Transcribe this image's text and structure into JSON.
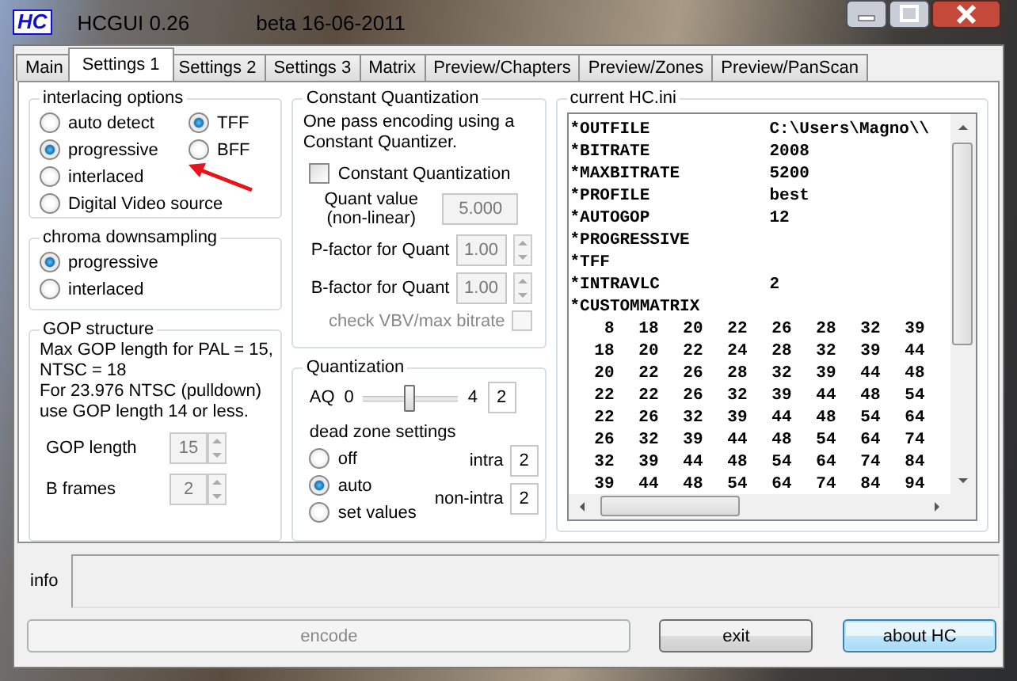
{
  "window": {
    "logo": "HC",
    "title": "HCGUI 0.26",
    "subtitle": "beta 16-06-2011"
  },
  "tabs": [
    {
      "label": "Main",
      "selected": false
    },
    {
      "label": "Settings 1",
      "selected": true
    },
    {
      "label": "Settings 2",
      "selected": false
    },
    {
      "label": "Settings 3",
      "selected": false
    },
    {
      "label": "Matrix",
      "selected": false
    },
    {
      "label": "Preview/Chapters",
      "selected": false
    },
    {
      "label": "Preview/Zones",
      "selected": false
    },
    {
      "label": "Preview/PanScan",
      "selected": false
    }
  ],
  "interlacing": {
    "title": "interlacing options",
    "options": [
      {
        "label": "auto detect",
        "selected": false
      },
      {
        "label": "progressive",
        "selected": true
      },
      {
        "label": "interlaced",
        "selected": false
      },
      {
        "label": "Digital Video source",
        "selected": false
      }
    ],
    "field_order": [
      {
        "label": "TFF",
        "selected": true
      },
      {
        "label": "BFF",
        "selected": false
      }
    ]
  },
  "chroma": {
    "title": "chroma downsampling",
    "options": [
      {
        "label": "progressive",
        "selected": true
      },
      {
        "label": "interlaced",
        "selected": false
      }
    ]
  },
  "gop": {
    "title": "GOP structure",
    "notes": [
      "Max GOP length for PAL = 15, NTSC = 18",
      "For 23.976 NTSC (pulldown) use GOP length 14 or less."
    ],
    "fields": [
      {
        "label": "GOP length",
        "value": "15",
        "disabled": true
      },
      {
        "label": "B frames",
        "value": "2",
        "disabled": true
      }
    ]
  },
  "constant_quantization": {
    "title": "Constant Quantization",
    "description": "One pass encoding using a Constant Quantizer.",
    "checkbox": {
      "label": "Constant Quantization",
      "checked": false
    },
    "quant_value": {
      "label": "Quant value (non-linear)",
      "value": "5.000",
      "disabled": true
    },
    "factors": [
      {
        "label": "P-factor for Quant",
        "value": "1.00",
        "disabled": true
      },
      {
        "label": "B-factor for Quant",
        "value": "1.00",
        "disabled": true
      }
    ],
    "vbv": {
      "label": "check VBV/max bitrate",
      "disabled": true
    }
  },
  "quantization": {
    "title": "Quantization",
    "aq": {
      "label": "AQ",
      "min": "0",
      "max": "4",
      "level": 0.5,
      "value": "2"
    },
    "dead_zone": {
      "title": "dead zone settings",
      "options": [
        {
          "label": "off",
          "selected": false
        },
        {
          "label": "auto",
          "selected": true
        },
        {
          "label": "set values",
          "selected": false
        }
      ],
      "fields": [
        {
          "label": "intra",
          "value": "2"
        },
        {
          "label": "non-intra",
          "value": "2"
        }
      ]
    }
  },
  "ini": {
    "title": "current HC.ini",
    "entries": [
      {
        "key": "*OUTFILE",
        "value": "C:\\Users\\Magno\\\\"
      },
      {
        "key": "*BITRATE",
        "value": "2008"
      },
      {
        "key": "*MAXBITRATE",
        "value": "5200"
      },
      {
        "key": "*PROFILE",
        "value": "best"
      },
      {
        "key": "*AUTOGOP",
        "value": "12"
      },
      {
        "key": "*PROGRESSIVE"
      },
      {
        "key": "*TFF"
      },
      {
        "key": "*INTRAVLC",
        "value": "2"
      },
      {
        "key": "*CUSTOMMATRIX"
      }
    ],
    "matrix": [
      [
        "8",
        "18",
        "20",
        "22",
        "26",
        "28",
        "32",
        "39"
      ],
      [
        "18",
        "20",
        "22",
        "24",
        "28",
        "32",
        "39",
        "44"
      ],
      [
        "20",
        "22",
        "26",
        "28",
        "32",
        "39",
        "44",
        "48"
      ],
      [
        "22",
        "22",
        "26",
        "32",
        "39",
        "44",
        "48",
        "54"
      ],
      [
        "22",
        "26",
        "32",
        "39",
        "44",
        "48",
        "54",
        "64"
      ],
      [
        "26",
        "32",
        "39",
        "44",
        "48",
        "54",
        "64",
        "74"
      ],
      [
        "32",
        "39",
        "44",
        "48",
        "54",
        "64",
        "74",
        "84"
      ],
      [
        "39",
        "44",
        "48",
        "54",
        "64",
        "74",
        "84",
        "94"
      ]
    ]
  },
  "info": {
    "label": "info"
  },
  "buttons": [
    {
      "label": "encode",
      "kind": "wide",
      "disabled": true,
      "default": false
    },
    {
      "label": "exit",
      "kind": "normal",
      "disabled": false,
      "default": false
    },
    {
      "label": "about HC",
      "kind": "normal",
      "disabled": false,
      "default": true
    }
  ]
}
